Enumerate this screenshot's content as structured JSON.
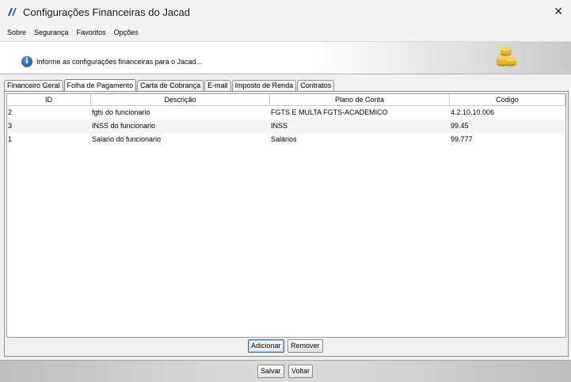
{
  "window": {
    "title": "Configurações Financeiras do Jacad",
    "close_glyph": "✕",
    "logo_icon": "jacad-logo-icon"
  },
  "menu": [
    "Sobre",
    "Segurança",
    "Favoritos",
    "Opções"
  ],
  "info": {
    "text": "Informe as configurações financeiras para o Jacad...",
    "icon": "info-icon",
    "decor_icon": "coins-icon",
    "info_glyph": "i"
  },
  "tabs": [
    "Financeiro Geral",
    "Folha de Pagamento",
    "Carta de Cobrança",
    "E-mail",
    "Imposto de Renda",
    "Contratos"
  ],
  "active_tab": "Folha de Pagamento",
  "table": {
    "columns": [
      "ID",
      "Descrição",
      "Plano de Conta",
      "Codigo"
    ],
    "rows": [
      [
        "2",
        "fgts do funcionario",
        "FGTS E MULTA FGTS-ACADEMICO",
        "4.2.10.10.006"
      ],
      [
        "3",
        "INSS do funcionario",
        "INSS",
        "99.45"
      ],
      [
        "1",
        "Salario do funcionario",
        "Salários",
        "99.777"
      ]
    ]
  },
  "tab_buttons": {
    "add": "Adicionar",
    "remove": "Remover"
  },
  "dialog_buttons": {
    "save": "Salvar",
    "back": "Voltar"
  },
  "colors": {
    "accent": "#0f4fa8",
    "focus": "#3c6fb6"
  }
}
